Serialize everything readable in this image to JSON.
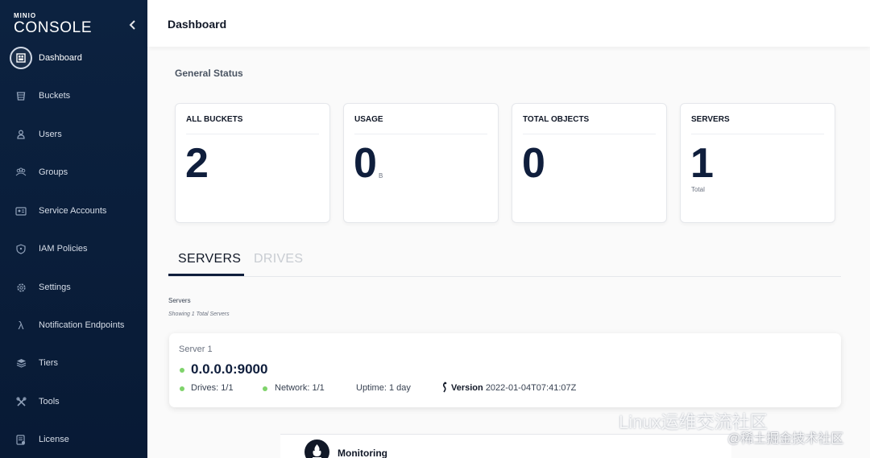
{
  "logo": {
    "line1": "MINIO",
    "line2": "CONSOLE"
  },
  "sidebar": {
    "items": [
      {
        "label": "Dashboard",
        "icon": "dashboard-icon",
        "active": true
      },
      {
        "label": "Buckets",
        "icon": "bucket-icon"
      },
      {
        "label": "Users",
        "icon": "user-icon"
      },
      {
        "label": "Groups",
        "icon": "groups-icon"
      },
      {
        "label": "Service Accounts",
        "icon": "service-accounts-icon"
      },
      {
        "label": "IAM Policies",
        "icon": "shield-icon"
      },
      {
        "label": "Settings",
        "icon": "gear-icon"
      },
      {
        "label": "Notification Endpoints",
        "icon": "lambda-icon"
      },
      {
        "label": "Tiers",
        "icon": "tiers-icon"
      },
      {
        "label": "Tools",
        "icon": "tools-icon"
      },
      {
        "label": "License",
        "icon": "license-icon"
      }
    ]
  },
  "header": {
    "title": "Dashboard"
  },
  "general_status": {
    "title": "General Status",
    "cards": [
      {
        "title": "ALL BUCKETS",
        "value": "2"
      },
      {
        "title": "USAGE",
        "value": "0",
        "unit": "B"
      },
      {
        "title": "TOTAL OBJECTS",
        "value": "0"
      },
      {
        "title": "SERVERS",
        "value": "1",
        "sub": "Total"
      }
    ]
  },
  "tabs": {
    "servers": "SERVERS",
    "drives": "DRIVES"
  },
  "servers_section": {
    "label": "Servers",
    "showing": "Showing 1 Total Servers",
    "server": {
      "name": "Server 1",
      "address": "0.0.0.0:9000",
      "drives": "Drives: 1/1",
      "network": "Network: 1/1",
      "uptime": "Uptime: 1 day",
      "version_label": "Version",
      "version_value": "2022-01-04T07:41:07Z"
    }
  },
  "monitoring": {
    "label": "Monitoring"
  },
  "watermark": {
    "line1": "Linux运维交流社区",
    "line2": "@稀土掘金技术社区"
  },
  "colors": {
    "sidebar_bg": "#0c2240",
    "accent": "#0f1e3c",
    "status_ok": "#7fd36b"
  }
}
